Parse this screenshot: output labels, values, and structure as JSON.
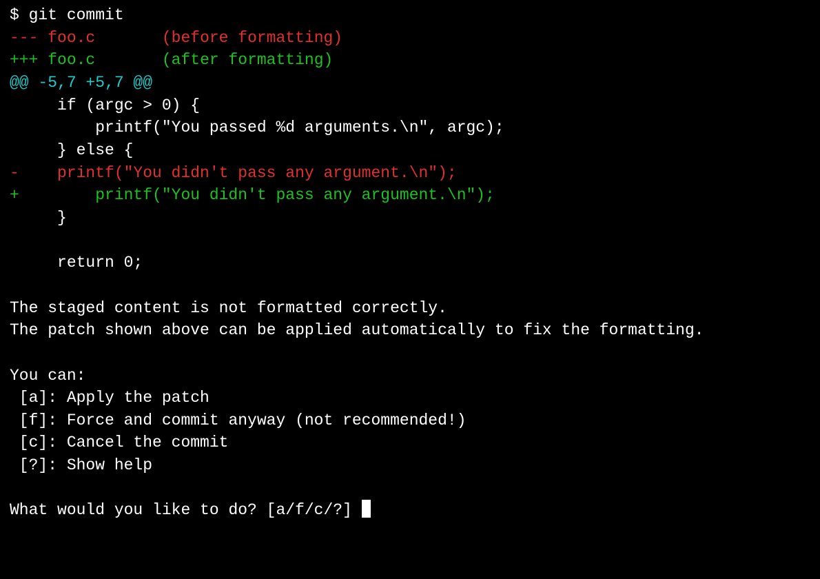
{
  "command": {
    "prompt": "$ ",
    "text": "git commit"
  },
  "diff": {
    "before": {
      "marker": "--- ",
      "file": "foo.c",
      "spacing": "       ",
      "label": "(before formatting)"
    },
    "after": {
      "marker": "+++ ",
      "file": "foo.c",
      "spacing": "       ",
      "label": "(after formatting)"
    },
    "hunk": "@@ -5,7 +5,7 @@",
    "lines": [
      "     if (argc > 0) {",
      "         printf(\"You passed %d arguments.\\n\", argc);",
      "     } else {",
      "-    printf(\"You didn't pass any argument.\\n\");",
      "+        printf(\"You didn't pass any argument.\\n\");",
      "     }",
      " ",
      "     return 0;"
    ]
  },
  "message": {
    "lines": [
      "The staged content is not formatted correctly.",
      "The patch shown above can be applied automatically to fix the formatting."
    ]
  },
  "options": {
    "header": "You can:",
    "items": [
      " [a]: Apply the patch",
      " [f]: Force and commit anyway (not recommended!)",
      " [c]: Cancel the commit",
      " [?]: Show help"
    ]
  },
  "prompt": {
    "question": "What would you like to do? [a/f/c/?] "
  }
}
